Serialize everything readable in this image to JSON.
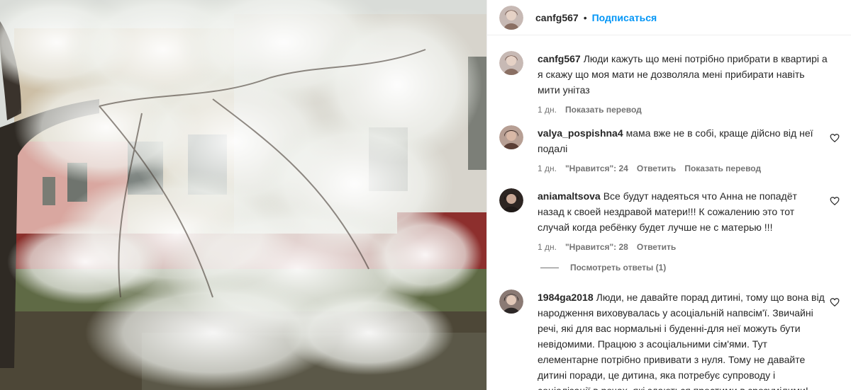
{
  "post": {
    "author": "canfg567",
    "separator": "•",
    "follow_label": "Подписаться"
  },
  "caption": {
    "username": "canfg567",
    "text": "Люди кажуть що мені потрібно прибрати в квартирі а я скажу що моя мати не дозволяла мені прибирати навіть мити унітаз",
    "time": "1 дн.",
    "translate_label": "Показать перевод"
  },
  "comments": [
    {
      "username": "valya_pospishna4",
      "text": "мама вже не в собі, краще дійсно від неї подалі",
      "time": "1 дн.",
      "likes_label": "\"Нравится\": 24",
      "reply_label": "Ответить",
      "translate_label": "Показать перевод"
    },
    {
      "username": "aniamaltsova",
      "text": "Все будут надеяться что Анна не попадёт назад к своей нездравой матери!!! К сожалению это тот случай когда ребёнку будет лучше не с матерью !!!",
      "time": "1 дн.",
      "likes_label": "\"Нравится\": 28",
      "reply_label": "Ответить",
      "view_replies_label": "Посмотреть ответы (1)"
    },
    {
      "username": "1984ga2018",
      "text": "Люди, не давайте порад дитині, тому що вона від народження виховувалась у асоціальній напвсім'ї. Звичайні речі, які для вас нормальні і буденні-для неї можуть бути невідомими. Працюю з асоціальними сім'ями. Тут елементарне потрібно прививати з нуля. Тому не давайте дитині поради, це дитина, яка потребує супроводу і соціалізації в речах, які здаються простими в зрозумілими!"
    }
  ],
  "icons": {
    "like": "heart-outline-icon"
  },
  "colors": {
    "accent": "#0095f6",
    "text": "#262626",
    "secondary": "#737373"
  }
}
